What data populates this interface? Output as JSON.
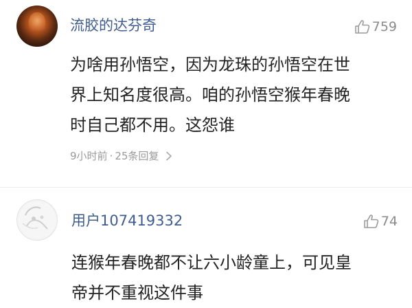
{
  "comments": [
    {
      "username": "流胶的达芬奇",
      "likes": "759",
      "lines": [
        "为啥用孙悟空，因为龙珠的孙悟空在世",
        "界上知名度很高。咱的孙悟空猴年春晚",
        "时自己都不用。这怨谁"
      ],
      "time": "9小时前",
      "dot": "·",
      "replies": "25条回复"
    },
    {
      "username": "用户107419332",
      "likes": "74",
      "lines": [
        "连猴年春晚都不让六小龄童上，可见皇",
        "帝并不重视这件事"
      ]
    }
  ],
  "icons": {
    "like": "thumbs-up-outline-icon",
    "reply_arrow": "chevron-right-icon"
  },
  "colors": {
    "username": "#3f5c8f",
    "body": "#222222",
    "meta": "#9a9a9a",
    "likes": "#8a8a8a",
    "background": "#ffffff"
  }
}
